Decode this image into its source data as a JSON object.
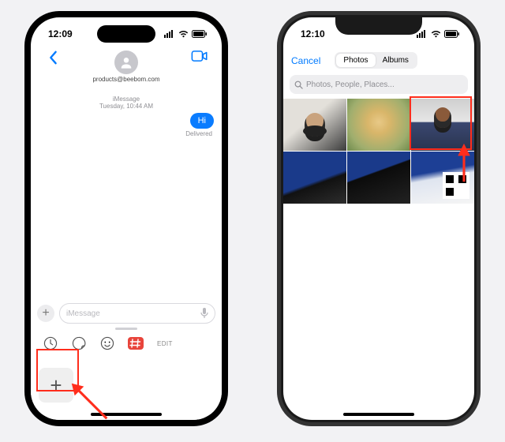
{
  "left": {
    "status_time": "12:09",
    "nav": {
      "contact": "products@beebom.com"
    },
    "thread": {
      "stamp_label": "iMessage",
      "stamp_time": "Tuesday, 10:44 AM",
      "bubble_text": "Hi",
      "delivered": "Delivered"
    },
    "input": {
      "placeholder": "iMessage",
      "edit_label": "EDIT",
      "plus_glyph": "+",
      "mic_glyph": " "
    },
    "bigplus_glyph": "+"
  },
  "right": {
    "status_time": "12:10",
    "sheet": {
      "cancel": "Cancel",
      "seg_photos": "Photos",
      "seg_albums": "Albums",
      "search_placeholder": "Photos, People, Places..."
    }
  },
  "colors": {
    "blue": "#007aff",
    "red": "#ff2d1c"
  }
}
